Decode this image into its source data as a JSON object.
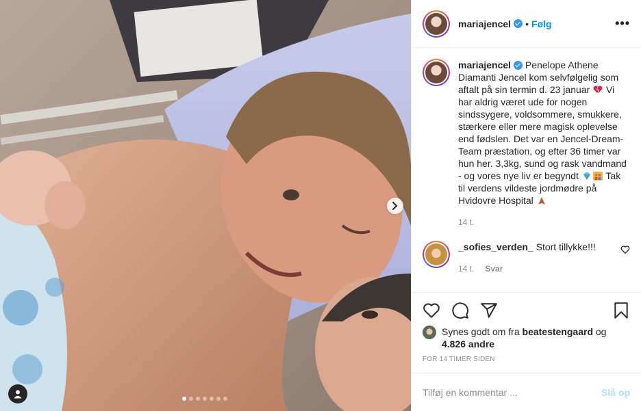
{
  "header": {
    "username": "mariajencel",
    "separator": "•",
    "follow_label": "Følg",
    "more_icon": "more-options-icon"
  },
  "caption": {
    "username": "mariajencel",
    "text_part1": "Penelope Athene Diamanti Jencel kom selvfølgelig som aftalt på sin termin d. 23 januar",
    "text_part2": "Vi har aldrig været ude for nogen sindssygere, voldsommere, smukkere, stærkere eller mere magisk oplevelse end fødslen. Det var en Jencel-Dream-Team præstation, og efter 36 timer var hun her. 3,3kg, sund og rask vandmand - og vores nye liv er begyndt",
    "text_part3": "Tak til verdens vildeste jordmødre på Hvidovre Hospital",
    "time": "14 t."
  },
  "comments": [
    {
      "username": "_sofies_verden_",
      "text": "Stort tillykke!!!",
      "time": "14 t.",
      "reply_label": "Svar"
    }
  ],
  "likes": {
    "prefix": "Synes godt om fra",
    "user": "beatestengaard",
    "joiner": "og",
    "count": "4.826 andre"
  },
  "timestamp": "FOR 14 TIMER SIDEN",
  "add_comment": {
    "placeholder": "Tilføj en kommentar ...",
    "post_label": "Slå op"
  },
  "carousel": {
    "total": 7,
    "active": 0
  },
  "colors": {
    "accent": "#0095f6",
    "post_disabled": "#b2dffc",
    "muted": "#8e8e8e"
  }
}
